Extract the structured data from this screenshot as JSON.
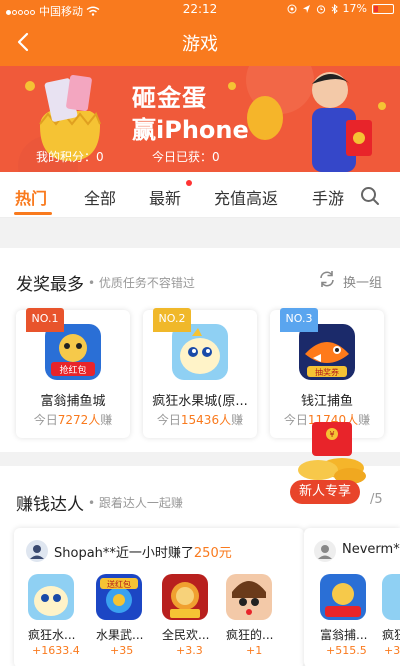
{
  "status": {
    "carrier": "中国移动",
    "time": "22:12",
    "battery": "17%",
    "battery_level": 0.17
  },
  "nav": {
    "title": "游戏"
  },
  "banner": {
    "headline_1": "砸金蛋",
    "headline_2": "赢iPhone",
    "my_points": "我的积分：0",
    "today_got": "今日已获：0"
  },
  "tabs": [
    {
      "label": "热门"
    },
    {
      "label": "全部"
    },
    {
      "label": "最新"
    },
    {
      "label": "充值高返"
    },
    {
      "label": "手游"
    }
  ],
  "section_top": {
    "title": "发奖最多",
    "subtitle": "• 优质任务不容错过",
    "refresh_label": "换一组",
    "cards": [
      {
        "badge": "NO.1",
        "name": "富翁捕鱼城",
        "prefix": "今日",
        "count": "7272人",
        "suffix": "赚"
      },
      {
        "badge": "NO.2",
        "name": "疯狂水果城(原...",
        "prefix": "今日",
        "count": "15436人",
        "suffix": "赚"
      },
      {
        "badge": "NO.3",
        "name": "钱江捕鱼",
        "prefix": "今日",
        "count": "11740人",
        "suffix": "赚"
      }
    ]
  },
  "section_earners": {
    "title": "赚钱达人",
    "subtitle": "• 跟着达人一起赚",
    "newbie_label": "新人专享",
    "pager": "/5",
    "people": [
      {
        "name": "Shopah**近一小时赚了",
        "amount": "250元",
        "games": [
          {
            "name": "疯狂水...",
            "points": "+1633.4"
          },
          {
            "name": "水果武...",
            "points": "+35"
          },
          {
            "name": "全民欢...",
            "points": "+3.3"
          },
          {
            "name": "疯狂的...",
            "points": "+1"
          }
        ]
      },
      {
        "name": "Neverm**",
        "amount": "",
        "games": [
          {
            "name": "富翁捕...",
            "points": "+515.5"
          },
          {
            "name": "疯狂",
            "points": "+35"
          }
        ]
      }
    ]
  },
  "colors": {
    "brand_orange": "#f97a1e",
    "banner_red": "#f05a3a"
  }
}
